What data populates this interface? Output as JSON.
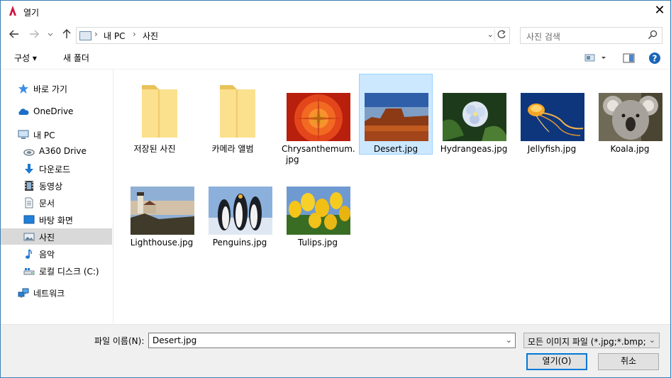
{
  "window": {
    "title": "열기",
    "close_glyph": "✕"
  },
  "address": {
    "crumbs": [
      "내 PC",
      "사진"
    ]
  },
  "search": {
    "placeholder": "사진 검색"
  },
  "toolbar": {
    "organize": "구성 ▾",
    "new_folder": "새 폴더"
  },
  "nav": [
    {
      "label": "바로 가기",
      "icon": "star-icon"
    },
    {
      "label": "OneDrive",
      "icon": "cloud-icon"
    },
    {
      "label": "내 PC",
      "icon": "computer-icon"
    },
    {
      "label": "A360 Drive",
      "icon": "a360-drive-icon"
    },
    {
      "label": "다운로드",
      "icon": "download-arrow-icon"
    },
    {
      "label": "동영상",
      "icon": "film-icon"
    },
    {
      "label": "문서",
      "icon": "document-icon"
    },
    {
      "label": "바탕 화면",
      "icon": "desktop-icon"
    },
    {
      "label": "사진",
      "icon": "pictures-icon",
      "selected": true
    },
    {
      "label": "음악",
      "icon": "music-note-icon"
    },
    {
      "label": "로컬 디스크 (C:)",
      "icon": "drive-icon"
    },
    {
      "label": "네트워크",
      "icon": "network-icon"
    }
  ],
  "items": [
    {
      "name": "저장된 사진",
      "type": "folder"
    },
    {
      "name": "카메라 앨범",
      "type": "folder"
    },
    {
      "name": "Chrysanthemum.jpg",
      "type": "image",
      "name_lines": [
        "Chrysanthemum.",
        "jpg"
      ]
    },
    {
      "name": "Desert.jpg",
      "type": "image",
      "selected": true
    },
    {
      "name": "Hydrangeas.jpg",
      "type": "image"
    },
    {
      "name": "Jellyfish.jpg",
      "type": "image"
    },
    {
      "name": "Koala.jpg",
      "type": "image"
    },
    {
      "name": "Lighthouse.jpg",
      "type": "image"
    },
    {
      "name": "Penguins.jpg",
      "type": "image"
    },
    {
      "name": "Tulips.jpg",
      "type": "image"
    }
  ],
  "footer": {
    "filename_label": "파일 이름(N):",
    "filename_value": "Desert.jpg",
    "filetype_value": "모든 이미지 파일 (*.jpg;*.bmp;",
    "open_label": "열기(O)",
    "cancel_label": "취소"
  },
  "colors": {
    "selection": "#cce8ff",
    "nav_selected": "#d9d9d9",
    "accent": "#0078d7"
  }
}
